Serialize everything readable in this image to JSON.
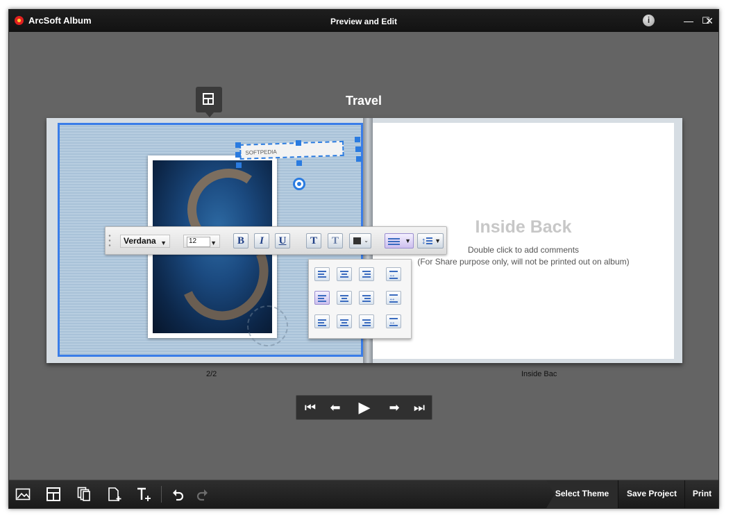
{
  "app": {
    "name": "ArcSoft Album",
    "window_title": "Preview and Edit"
  },
  "window_controls": {
    "info": "i",
    "minimize": "—",
    "maximize": "☐",
    "close": "✕"
  },
  "album": {
    "title": "Travel"
  },
  "left_page": {
    "textbox_text": "SOFTPEDIA",
    "page_label": "2/2"
  },
  "right_page": {
    "title": "Inside Back",
    "hint": "Double click to add comments",
    "note": "(For Share purpose only, will not be printed out on album)",
    "page_label": "Inside Bac"
  },
  "text_toolbar": {
    "font": "Verdana",
    "size": "12",
    "bold": "B",
    "italic": "I",
    "underline": "U",
    "text_style_1": "T",
    "text_style_2": "T",
    "dropdown_caret": "▼"
  },
  "navigation": {
    "first": "⏮",
    "prev": "⬅",
    "play": "▶",
    "next": "➡",
    "last": "⏭"
  },
  "bottom_bar": {
    "icons": [
      "add-photo-icon",
      "layout-icon",
      "pages-icon",
      "add-page-icon",
      "add-text-icon",
      "undo-icon",
      "redo-icon"
    ],
    "select_theme": "Select Theme",
    "save_project": "Save Project",
    "print": "Print"
  },
  "colors": {
    "accent": "#2a7be0",
    "background": "#646464",
    "bar": "#1a1a1a"
  }
}
